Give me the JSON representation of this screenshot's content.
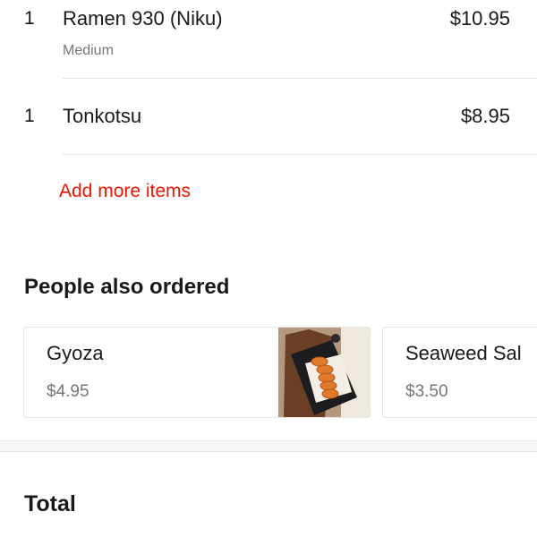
{
  "cart": {
    "items": [
      {
        "qty": "1",
        "name": "Ramen 930 (Niku)",
        "option": "Medium",
        "price": "$10.95"
      },
      {
        "qty": "1",
        "name": "Tonkotsu",
        "price": "$8.95"
      }
    ],
    "add_more_label": "Add more items"
  },
  "recommendations": {
    "title": "People also ordered",
    "cards": [
      {
        "name": "Gyoza",
        "price": "$4.95",
        "image": "gyoza-dish-photo"
      },
      {
        "name": "Seaweed Sal",
        "price": "$3.50"
      }
    ]
  },
  "summary": {
    "total_label": "Total"
  },
  "colors": {
    "accent": "#eb1700",
    "text_primary": "#191919",
    "text_secondary": "#767676",
    "divider": "#e4e4e4"
  }
}
